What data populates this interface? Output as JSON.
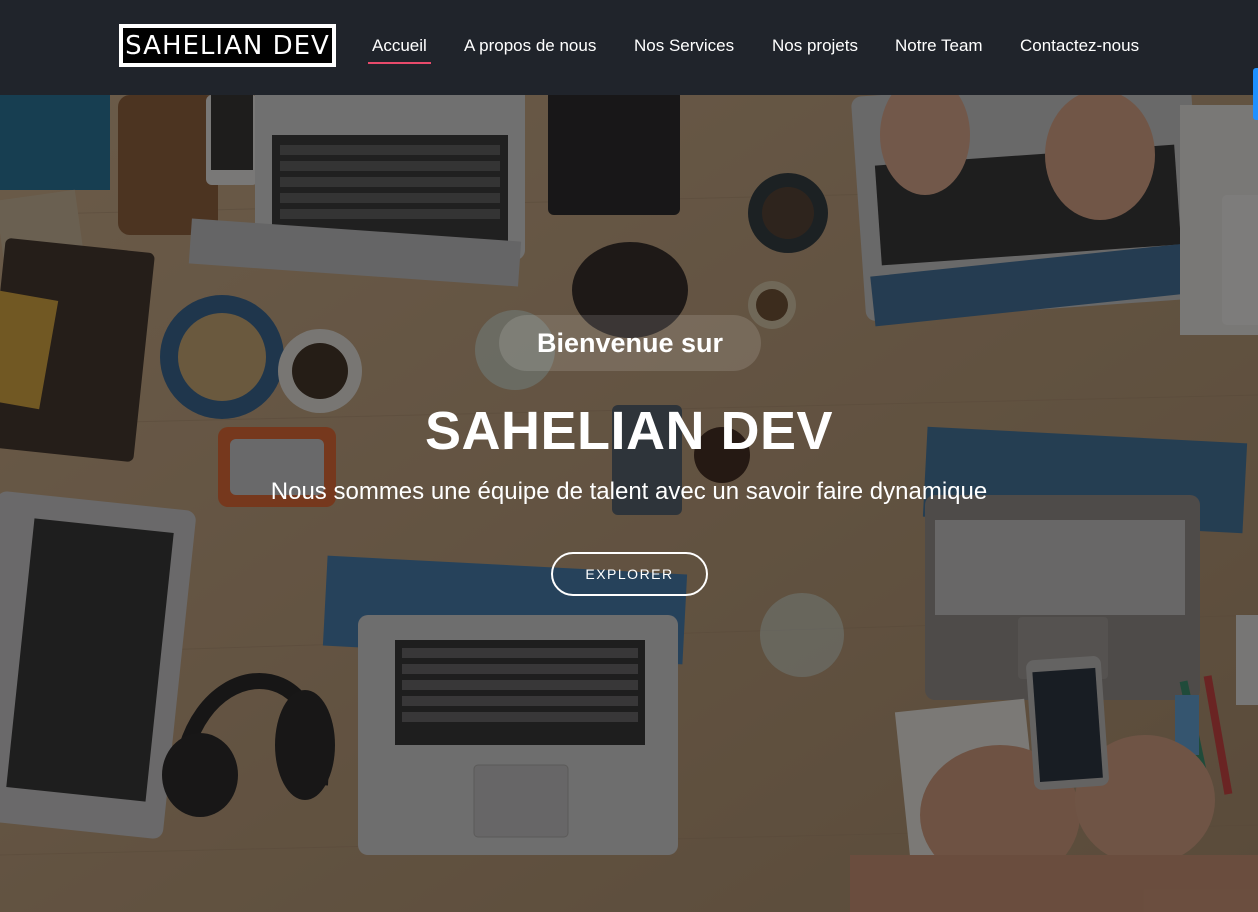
{
  "navbar": {
    "logo_text": "SAHELIAN DEV",
    "links": [
      {
        "label": "Accueil",
        "active": true
      },
      {
        "label": "A propos de nous",
        "active": false
      },
      {
        "label": "Nos Services",
        "active": false
      },
      {
        "label": "Nos projets",
        "active": false
      },
      {
        "label": "Notre Team",
        "active": false
      },
      {
        "label": "Contactez-nous",
        "active": false
      }
    ]
  },
  "hero": {
    "welcome": "Bienvenue sur",
    "title": "SAHELIAN DEV",
    "subtitle": "Nous sommes une équipe de talent avec un savoir faire dynamique",
    "button_label": "EXPLORER",
    "background_image": "team-desk-laptops-photo"
  },
  "colors": {
    "navbar_bg": "#20242b",
    "active_underline": "#e84a6b",
    "text": "#ffffff",
    "scroll_indicator": "#1e90ff"
  }
}
